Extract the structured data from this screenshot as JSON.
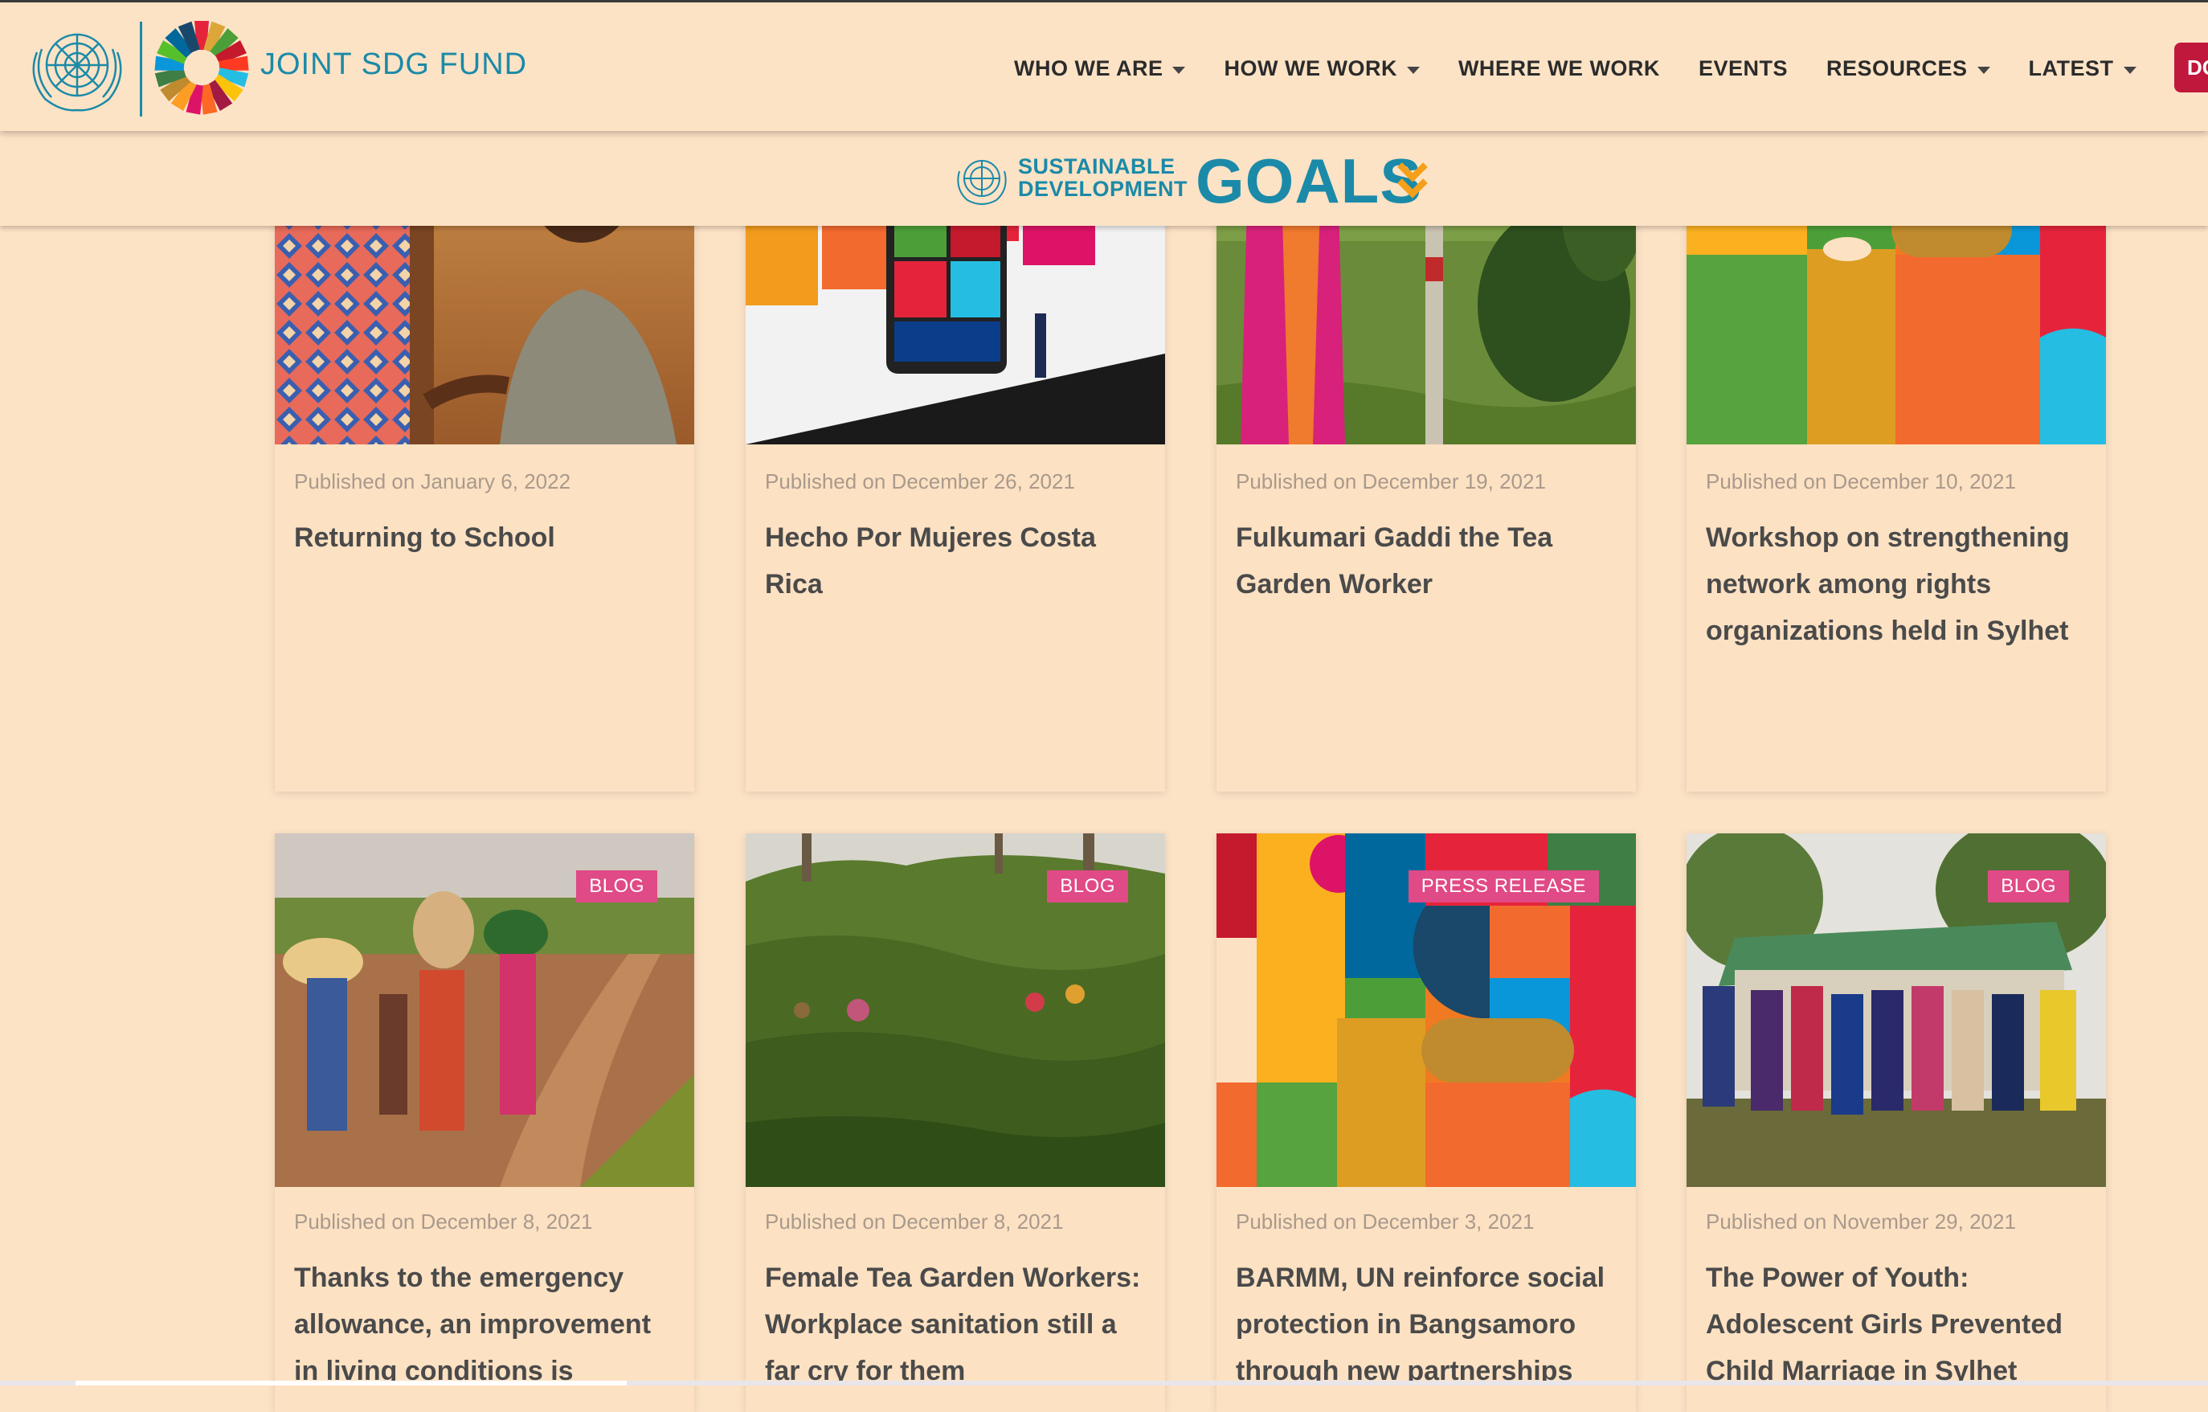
{
  "brand": {
    "name": "JOINT SDG FUND",
    "color": "#1b8aa8"
  },
  "nav": {
    "items": [
      {
        "label": "WHO WE ARE"
      },
      {
        "label": "HOW WE WORK"
      },
      {
        "label": "WHERE WE WORK"
      },
      {
        "label": "EVENTS"
      },
      {
        "label": "RESOURCES"
      },
      {
        "label": "LATEST"
      }
    ],
    "donate_label": "DO"
  },
  "sdg_banner": {
    "line1": "SUSTAINABLE",
    "line2": "DEVELOPMENT",
    "goals_word": "GOALS",
    "chevron_icon": "double-chevron-down-icon"
  },
  "cards": [
    {
      "date": "Published on January 6, 2022",
      "title": "Returning to School",
      "badge": ""
    },
    {
      "date": "Published on December 26, 2021",
      "title": "Hecho Por Mujeres Costa Rica",
      "badge": ""
    },
    {
      "date": "Published on December 19, 2021",
      "title": "Fulkumari Gaddi the Tea Garden Worker",
      "badge": ""
    },
    {
      "date": "Published on December 10, 2021",
      "title": "Workshop on strengthening network among rights organizations held in Sylhet",
      "badge": ""
    },
    {
      "date": "Published on December 8, 2021",
      "title": "Thanks to the emergency allowance, an improvement in living conditions is",
      "badge": "BLOG"
    },
    {
      "date": "Published on December 8, 2021",
      "title": "Female Tea Garden Workers: Workplace sanitation still a far cry for them",
      "badge": "BLOG"
    },
    {
      "date": "Published on December 3, 2021",
      "title": "BARMM, UN reinforce social protection in Bangsamoro through new partnerships",
      "badge": "PRESS RELEASE"
    },
    {
      "date": "Published on November 29, 2021",
      "title": "The Power of Youth: Adolescent Girls Prevented Child Marriage in Sylhet",
      "badge": "BLOG"
    }
  ],
  "colors": {
    "background": "#fde3c6",
    "badge": "#e04a86",
    "donate": "#c0183c"
  }
}
